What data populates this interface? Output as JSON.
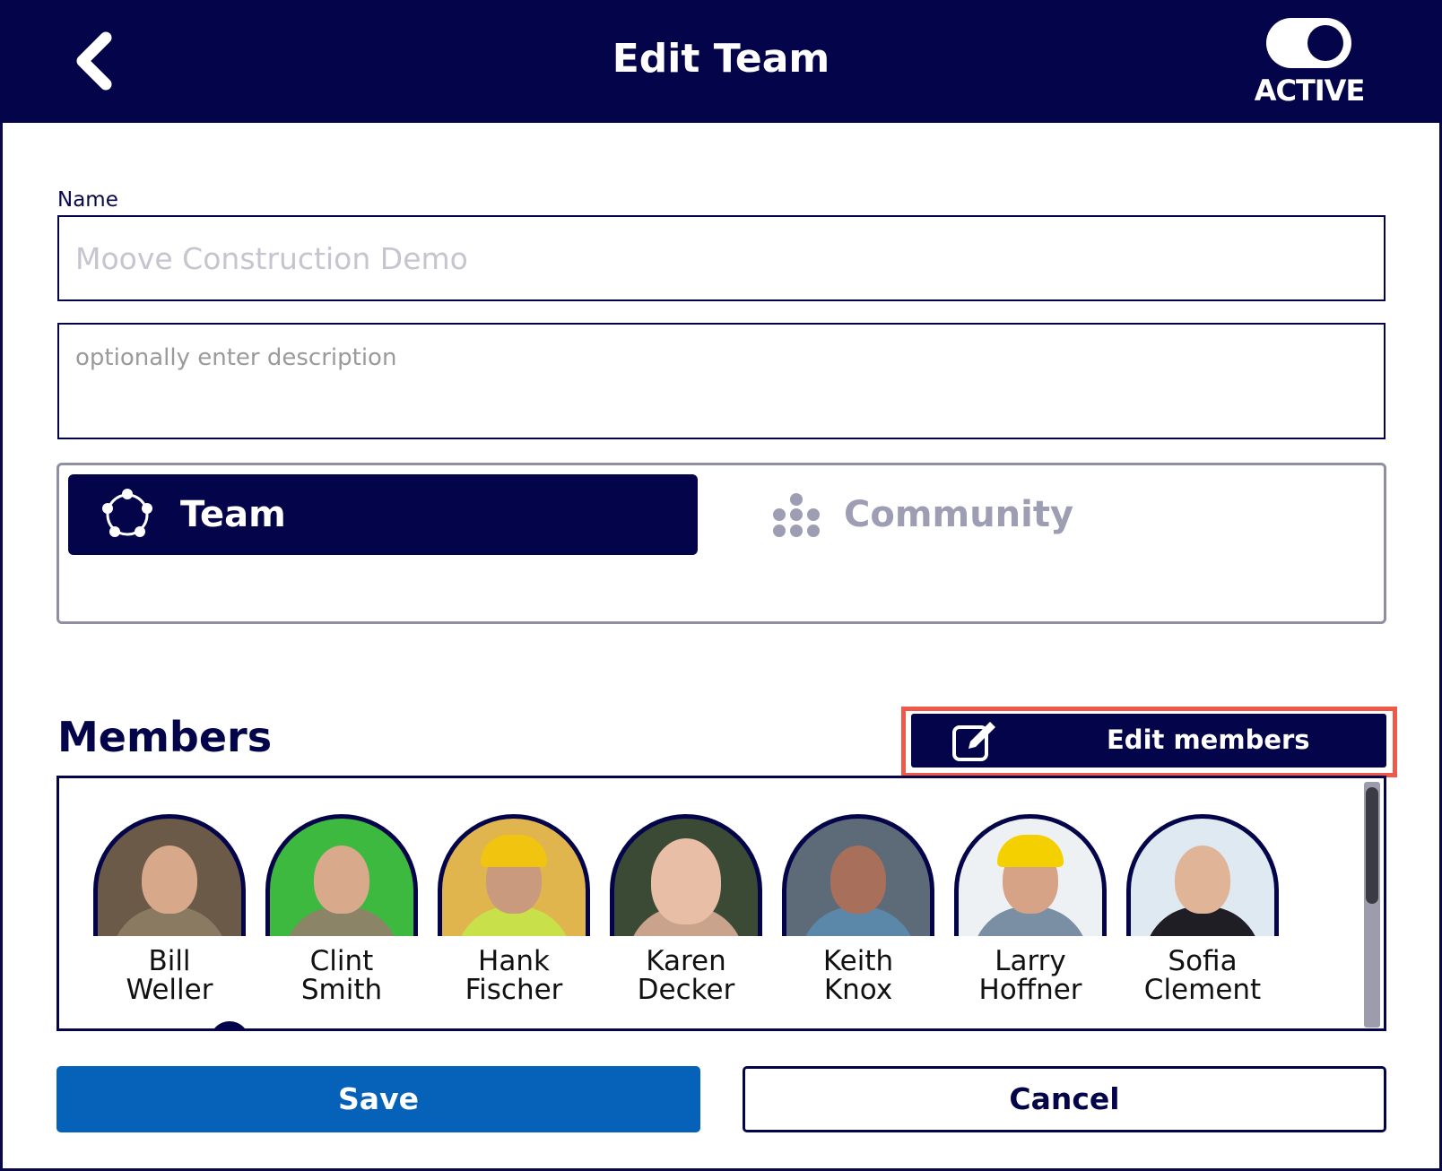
{
  "header": {
    "title": "Edit Team",
    "back_icon": "chevron-left-icon",
    "status_toggle": {
      "label": "ACTIVE",
      "on": true
    }
  },
  "form": {
    "name_label": "Name",
    "name_placeholder": "Moove Construction Demo",
    "description_placeholder": "optionally enter description"
  },
  "type_selector": {
    "options": [
      {
        "label": "Team",
        "icon": "team-circle-icon",
        "selected": true
      },
      {
        "label": "Community",
        "icon": "community-dots-icon",
        "selected": false
      }
    ]
  },
  "members": {
    "title": "Members",
    "edit_label": "Edit members",
    "edit_icon": "edit-pencil-icon",
    "list": [
      {
        "first": "Bill",
        "last": "Weller"
      },
      {
        "first": "Clint",
        "last": "Smith"
      },
      {
        "first": "Hank",
        "last": "Fischer"
      },
      {
        "first": "Karen",
        "last": "Decker"
      },
      {
        "first": "Keith",
        "last": "Knox"
      },
      {
        "first": "Larry",
        "last": "Hoffner"
      },
      {
        "first": "Sofia",
        "last": "Clement"
      }
    ]
  },
  "actions": {
    "save_label": "Save",
    "cancel_label": "Cancel"
  },
  "colors": {
    "navy": "#04044a",
    "save_blue": "#0562b8",
    "highlight": "#f0584a"
  }
}
